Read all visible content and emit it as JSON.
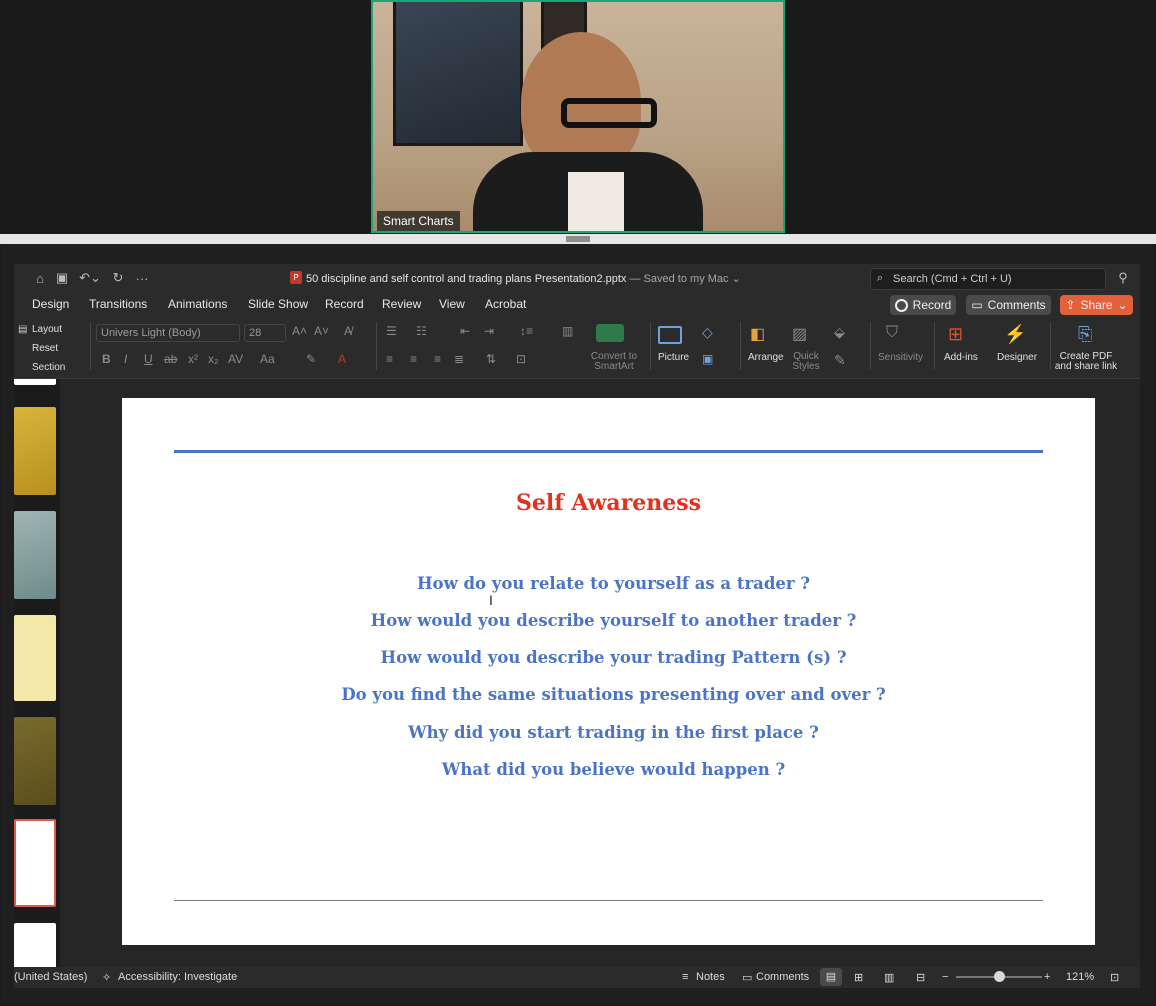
{
  "video": {
    "speaker_name": "Smart Charts"
  },
  "window": {
    "file_title": "50 discipline and self control and trading plans Presentation2.pptx",
    "save_status": "— Saved to my Mac"
  },
  "search": {
    "placeholder": "Search (Cmd + Ctrl + U)"
  },
  "tabs": [
    "Design",
    "Transitions",
    "Animations",
    "Slide Show",
    "Record",
    "Review",
    "View",
    "Acrobat"
  ],
  "actions": {
    "record": "Record",
    "comments": "Comments",
    "share": "Share"
  },
  "ribbon": {
    "layout": "Layout",
    "reset": "Reset",
    "section": "Section",
    "font_name": "Univers Light (Body)",
    "font_size": "28",
    "convert_smartart": "Convert to SmartArt",
    "picture": "Picture",
    "arrange": "Arrange",
    "quick_styles": "Quick Styles",
    "sensitivity": "Sensitivity",
    "addins": "Add-ins",
    "designer": "Designer",
    "create_pdf": "Create PDF and share link"
  },
  "slide": {
    "title": "Self Awareness",
    "questions": [
      "How do you relate to yourself as a trader ?",
      "How would you describe yourself to another trader ?",
      "How would you describe your trading Pattern (s) ?",
      "Do you find the same situations presenting over and over ?",
      "Why did you start trading in the first place ?",
      "What did you believe would happen ?"
    ],
    "title_color": "#e0321e",
    "text_color": "#4a74c4"
  },
  "status": {
    "language": "(United States)",
    "accessibility": "Accessibility: Investigate",
    "notes": "Notes",
    "comments": "Comments",
    "zoom": "121%"
  }
}
